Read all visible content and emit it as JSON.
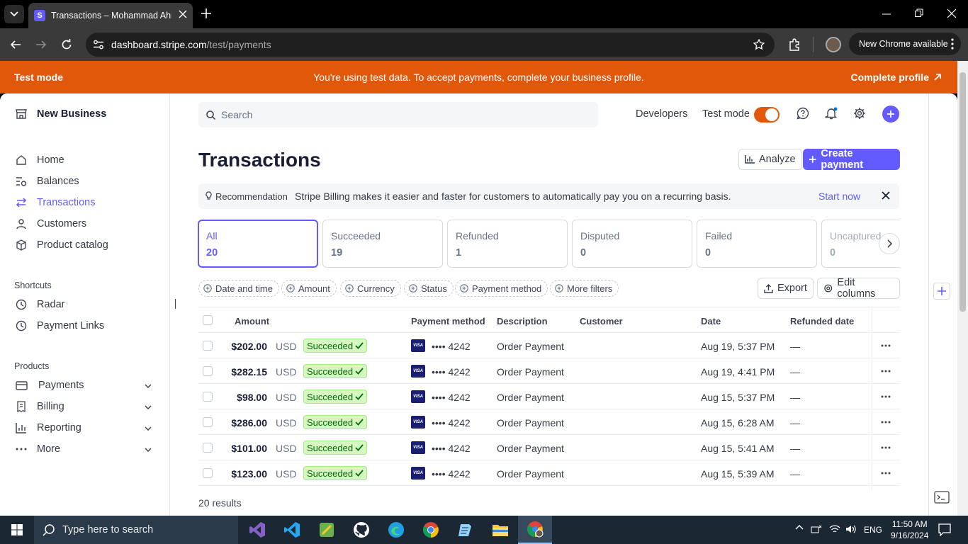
{
  "browser": {
    "tab_title": "Transactions – Mohammad Ahmed",
    "url_domain": "dashboard.stripe.com",
    "url_path": "/test/payments",
    "update_label": "New Chrome available"
  },
  "banner": {
    "left": "Test mode",
    "message": "You're using test data. To accept payments, complete your business profile.",
    "action": "Complete profile"
  },
  "sidebar": {
    "account": "New Business",
    "nav": [
      {
        "label": "Home",
        "icon": "home-icon"
      },
      {
        "label": "Balances",
        "icon": "balances-icon"
      },
      {
        "label": "Transactions",
        "icon": "transactions-icon",
        "active": true
      },
      {
        "label": "Customers",
        "icon": "customers-icon"
      },
      {
        "label": "Product catalog",
        "icon": "product-catalog-icon"
      }
    ],
    "shortcuts_heading": "Shortcuts",
    "shortcuts": [
      {
        "label": "Radar",
        "icon": "clock-icon"
      },
      {
        "label": "Payment Links",
        "icon": "clock-icon"
      }
    ],
    "products_heading": "Products",
    "products": [
      {
        "label": "Payments",
        "icon": "payments-icon"
      },
      {
        "label": "Billing",
        "icon": "billing-icon"
      },
      {
        "label": "Reporting",
        "icon": "reporting-icon"
      },
      {
        "label": "More",
        "icon": "more-icon"
      }
    ]
  },
  "header": {
    "search_placeholder": "Search",
    "developers": "Developers",
    "test_mode": "Test mode",
    "test_mode_on": true
  },
  "page": {
    "title": "Transactions",
    "analyze": "Analyze",
    "create_payment": "Create payment"
  },
  "recommendation": {
    "label": "Recommendation",
    "text": "Stripe Billing makes it easier and faster for customers to automatically pay you on a recurring basis.",
    "action": "Start now"
  },
  "stats": [
    {
      "label": "All",
      "value": "20"
    },
    {
      "label": "Succeeded",
      "value": "19"
    },
    {
      "label": "Refunded",
      "value": "1"
    },
    {
      "label": "Disputed",
      "value": "0"
    },
    {
      "label": "Failed",
      "value": "0"
    },
    {
      "label": "Uncaptured",
      "value": "0"
    }
  ],
  "filters": [
    "Date and time",
    "Amount",
    "Currency",
    "Status",
    "Payment method",
    "More filters"
  ],
  "toolbar": {
    "export": "Export",
    "edit_columns": "Edit columns"
  },
  "table": {
    "columns": [
      "Amount",
      "Payment method",
      "Description",
      "Customer",
      "Date",
      "Refunded date"
    ],
    "rows": [
      {
        "amount": "$202.00",
        "currency": "USD",
        "status": "Succeeded",
        "card": "•••• 4242",
        "description": "Order Payment",
        "customer": "",
        "date": "Aug 19, 5:37 PM",
        "refunded": "—"
      },
      {
        "amount": "$282.15",
        "currency": "USD",
        "status": "Succeeded",
        "card": "•••• 4242",
        "description": "Order Payment",
        "customer": "",
        "date": "Aug 19, 4:41 PM",
        "refunded": "—"
      },
      {
        "amount": "$98.00",
        "currency": "USD",
        "status": "Succeeded",
        "card": "•••• 4242",
        "description": "Order Payment",
        "customer": "",
        "date": "Aug 15, 5:37 PM",
        "refunded": "—"
      },
      {
        "amount": "$286.00",
        "currency": "USD",
        "status": "Succeeded",
        "card": "•••• 4242",
        "description": "Order Payment",
        "customer": "",
        "date": "Aug 15, 6:28 AM",
        "refunded": "—"
      },
      {
        "amount": "$101.00",
        "currency": "USD",
        "status": "Succeeded",
        "card": "•••• 4242",
        "description": "Order Payment",
        "customer": "",
        "date": "Aug 15, 5:41 AM",
        "refunded": "—"
      },
      {
        "amount": "$123.00",
        "currency": "USD",
        "status": "Succeeded",
        "card": "•••• 4242",
        "description": "Order Payment",
        "customer": "",
        "date": "Aug 15, 5:39 AM",
        "refunded": "—"
      }
    ],
    "visa_label": "VISA",
    "results": "20 results"
  },
  "taskbar": {
    "search_placeholder": "Type here to search",
    "language": "ENG",
    "time": "11:50 AM",
    "date": "9/16/2024"
  },
  "colors": {
    "accent": "#635bff",
    "test_mode": "#e2580b",
    "success_bg": "#d7f7c2",
    "success_text": "#05690d"
  }
}
